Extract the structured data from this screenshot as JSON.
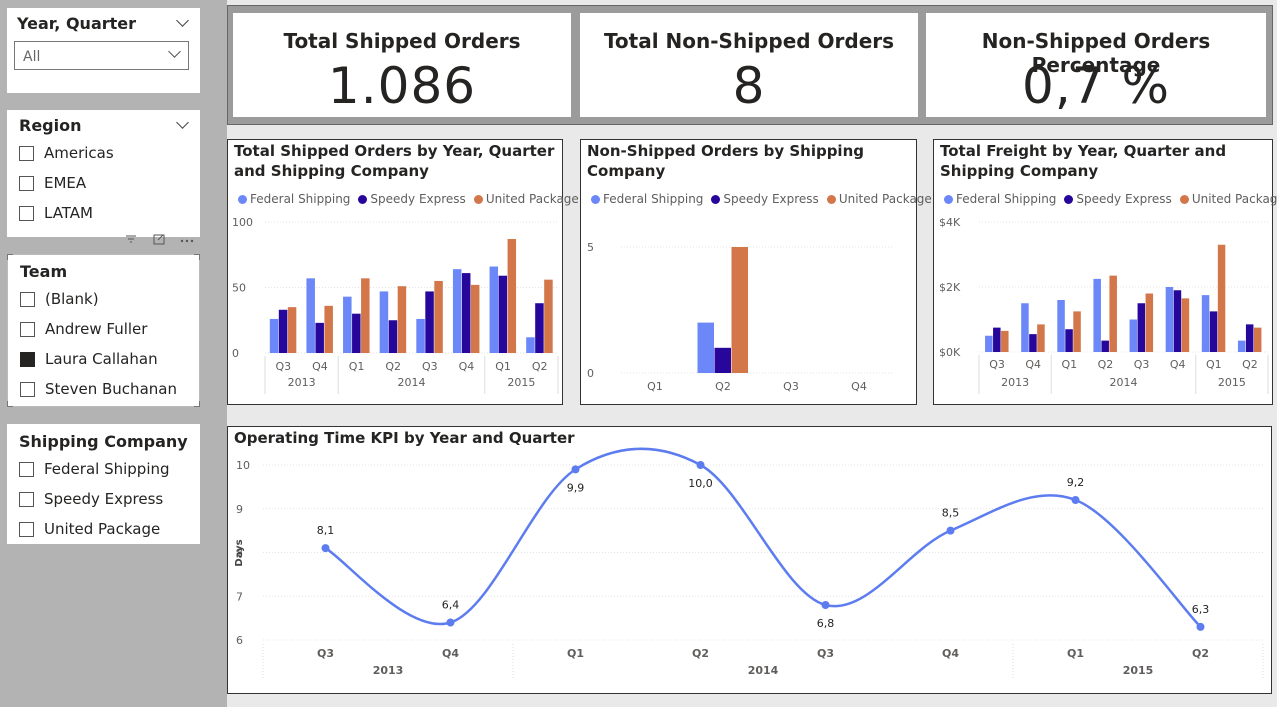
{
  "colors": {
    "federal": "#6B87F8",
    "speedy": "#27069C",
    "united": "#D3774A",
    "line": "#5C7CF0"
  },
  "slicers": {
    "year_quarter": {
      "title": "Year, Quarter",
      "selected": "All"
    },
    "region": {
      "title": "Region",
      "items": [
        "Americas",
        "EMEA",
        "LATAM"
      ]
    },
    "team": {
      "title": "Team",
      "items": [
        "(Blank)",
        "Andrew Fuller",
        "Laura Callahan",
        "Steven Buchanan"
      ],
      "checked": [
        false,
        false,
        true,
        false
      ]
    },
    "shipping_company": {
      "title": "Shipping Company",
      "items": [
        "Federal Shipping",
        "Speedy Express",
        "United Package"
      ]
    }
  },
  "cards": [
    {
      "title": "Total Shipped Orders",
      "value": "1.086"
    },
    {
      "title": "Total Non-Shipped Orders",
      "value": "8"
    },
    {
      "title": "Non-Shipped Orders Percentage",
      "value": "0,7 %"
    }
  ],
  "visuals": {
    "shipped": {
      "title": "Total Shipped Orders by Year, Quarter and Shipping Company"
    },
    "nonshipped": {
      "title": "Non-Shipped Orders by Shipping Company"
    },
    "freight": {
      "title": "Total Freight by Year, Quarter and Shipping Company"
    },
    "kpi": {
      "title": "Operating Time KPI by Year and Quarter"
    }
  },
  "legend": [
    "Federal Shipping",
    "Speedy Express",
    "United Package"
  ],
  "chart_data": [
    {
      "type": "bar",
      "id": "shipped",
      "title": "Total Shipped Orders by Year, Quarter and Shipping Company",
      "categories": [
        "Q3",
        "Q4",
        "Q1",
        "Q2",
        "Q3",
        "Q4",
        "Q1",
        "Q2"
      ],
      "groups": [
        {
          "label": "2013",
          "span": 2
        },
        {
          "label": "2014",
          "span": 4
        },
        {
          "label": "2015",
          "span": 2
        }
      ],
      "series": [
        {
          "name": "Federal Shipping",
          "values": [
            26,
            57,
            43,
            47,
            26,
            64,
            66,
            12
          ]
        },
        {
          "name": "Speedy Express",
          "values": [
            33,
            23,
            30,
            25,
            47,
            61,
            59,
            38
          ]
        },
        {
          "name": "United Package",
          "values": [
            35,
            36,
            57,
            51,
            55,
            52,
            87,
            56
          ]
        }
      ],
      "yticks": [
        "0",
        "50",
        "100"
      ],
      "ylim": [
        0,
        100
      ],
      "grid": true,
      "legend_position": "top-left"
    },
    {
      "type": "bar",
      "id": "nonshipped",
      "title": "Non-Shipped Orders by Shipping Company",
      "categories": [
        "Q1",
        "Q2",
        "Q3",
        "Q4"
      ],
      "series": [
        {
          "name": "Federal Shipping",
          "values": [
            0,
            2,
            0,
            0
          ]
        },
        {
          "name": "Speedy Express",
          "values": [
            0,
            1,
            0,
            0
          ]
        },
        {
          "name": "United Package",
          "values": [
            0,
            5,
            0,
            0
          ]
        }
      ],
      "yticks": [
        "0",
        "5"
      ],
      "ylim": [
        0,
        5
      ],
      "grid": true,
      "legend_position": "top-left"
    },
    {
      "type": "bar",
      "id": "freight",
      "title": "Total Freight by Year, Quarter and Shipping Company",
      "categories": [
        "Q3",
        "Q4",
        "Q1",
        "Q2",
        "Q3",
        "Q4",
        "Q1",
        "Q2"
      ],
      "groups": [
        {
          "label": "2013",
          "span": 2
        },
        {
          "label": "2014",
          "span": 4
        },
        {
          "label": "2015",
          "span": 2
        }
      ],
      "series": [
        {
          "name": "Federal Shipping",
          "values": [
            500,
            1500,
            1600,
            2250,
            1000,
            2000,
            1750,
            350
          ]
        },
        {
          "name": "Speedy Express",
          "values": [
            750,
            550,
            700,
            350,
            1500,
            1900,
            1250,
            850
          ]
        },
        {
          "name": "United Package",
          "values": [
            650,
            850,
            1250,
            2350,
            1800,
            1650,
            3300,
            750
          ]
        }
      ],
      "yticks": [
        "$0K",
        "$2K",
        "$4K"
      ],
      "ylim": [
        0,
        4000
      ],
      "grid": true,
      "legend_position": "top-left"
    },
    {
      "type": "line",
      "id": "kpi",
      "title": "Operating Time KPI by Year and Quarter",
      "categories": [
        "Q3",
        "Q4",
        "Q1",
        "Q2",
        "Q3",
        "Q4",
        "Q1",
        "Q2"
      ],
      "groups": [
        {
          "label": "2013",
          "span": 2
        },
        {
          "label": "2014",
          "span": 4
        },
        {
          "label": "2015",
          "span": 2
        }
      ],
      "series": [
        {
          "values": [
            8.1,
            6.4,
            9.9,
            10.0,
            6.8,
            8.5,
            9.2,
            6.3
          ],
          "labels": [
            "8,1",
            "6,4",
            "9,9",
            "10,0",
            "6,8",
            "8,5",
            "9,2",
            "6,3"
          ]
        }
      ],
      "ylabel": "Days",
      "yticks": [
        "6",
        "7",
        "8",
        "9",
        "10"
      ],
      "ylim": [
        6,
        10
      ],
      "grid": true
    }
  ]
}
